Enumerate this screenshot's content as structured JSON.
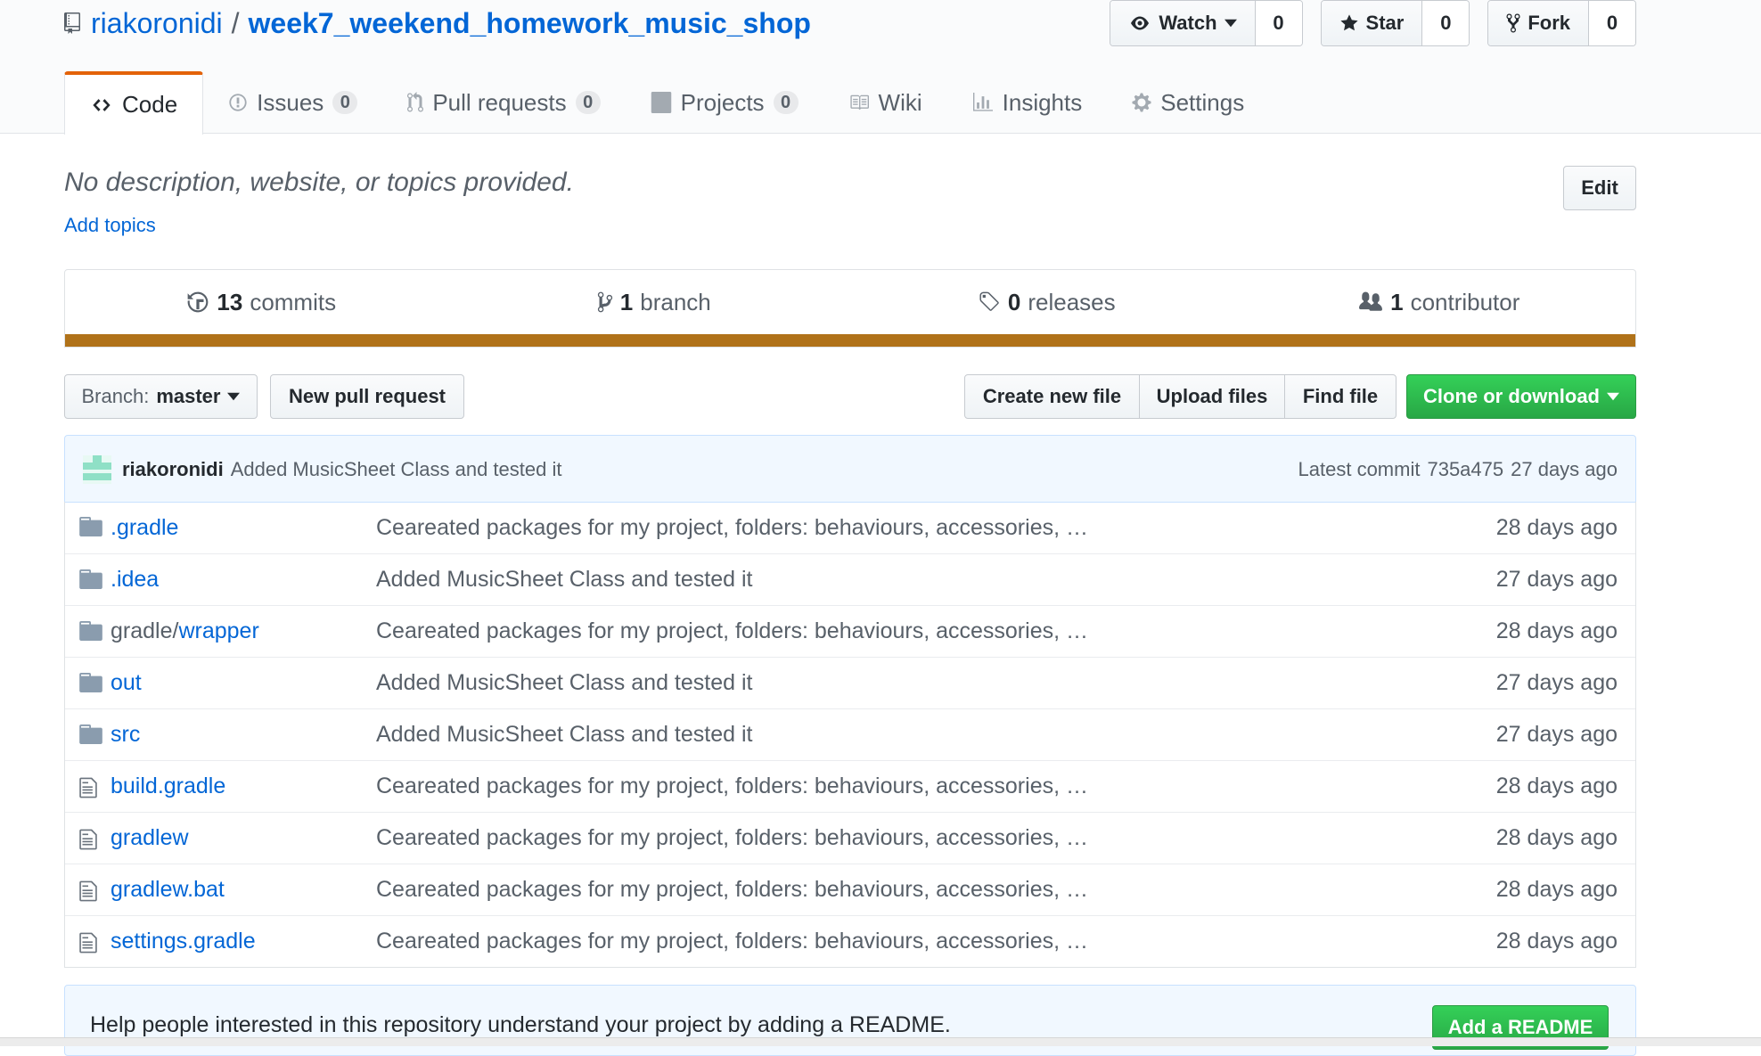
{
  "repo": {
    "owner": "riakoronidi",
    "separator": "/",
    "name": "week7_weekend_homework_music_shop"
  },
  "actions": {
    "watch": {
      "label": "Watch",
      "count": "0"
    },
    "star": {
      "label": "Star",
      "count": "0"
    },
    "fork": {
      "label": "Fork",
      "count": "0"
    }
  },
  "tabs": [
    {
      "label": "Code",
      "icon": "code-icon",
      "selected": true
    },
    {
      "label": "Issues",
      "counter": "0",
      "icon": "issue-icon"
    },
    {
      "label": "Pull requests",
      "counter": "0",
      "icon": "pull-request-icon"
    },
    {
      "label": "Projects",
      "counter": "0",
      "icon": "project-icon"
    },
    {
      "label": "Wiki",
      "icon": "book-icon"
    },
    {
      "label": "Insights",
      "icon": "graph-icon"
    },
    {
      "label": "Settings",
      "icon": "gear-icon"
    }
  ],
  "description": {
    "text": "No description, website, or topics provided.",
    "add_topics": "Add topics",
    "edit_label": "Edit"
  },
  "summary": {
    "commits_count": "13",
    "commits_label": "commits",
    "branches_count": "1",
    "branches_label": "branch",
    "releases_count": "0",
    "releases_label": "releases",
    "contributors_count": "1",
    "contributors_label": "contributor",
    "language_color": "#b07219"
  },
  "filenav": {
    "branch_prefix": "Branch:",
    "branch_name": "master",
    "new_pr": "New pull request",
    "create_file": "Create new file",
    "upload_files": "Upload files",
    "find_file": "Find file",
    "clone": "Clone or download"
  },
  "latest_commit": {
    "author": "riakoronidi",
    "message": "Added MusicSheet Class and tested it",
    "label": "Latest commit",
    "sha": "735a475",
    "age": "27 days ago"
  },
  "files": [
    {
      "name": ".gradle",
      "type": "dir",
      "message": "Ceareated packages for my project, folders: behaviours, accessories, …",
      "age": "28 days ago"
    },
    {
      "name": ".idea",
      "type": "dir",
      "message": "Added MusicSheet Class and tested it",
      "age": "27 days ago"
    },
    {
      "dir_prefix": "gradle/",
      "name": "wrapper",
      "type": "dir",
      "message": "Ceareated packages for my project, folders: behaviours, accessories, …",
      "age": "28 days ago"
    },
    {
      "name": "out",
      "type": "dir",
      "message": "Added MusicSheet Class and tested it",
      "age": "27 days ago"
    },
    {
      "name": "src",
      "type": "dir",
      "message": "Added MusicSheet Class and tested it",
      "age": "27 days ago"
    },
    {
      "name": "build.gradle",
      "type": "file",
      "message": "Ceareated packages for my project, folders: behaviours, accessories, …",
      "age": "28 days ago"
    },
    {
      "name": "gradlew",
      "type": "file",
      "message": "Ceareated packages for my project, folders: behaviours, accessories, …",
      "age": "28 days ago"
    },
    {
      "name": "gradlew.bat",
      "type": "file",
      "message": "Ceareated packages for my project, folders: behaviours, accessories, …",
      "age": "28 days ago"
    },
    {
      "name": "settings.gradle",
      "type": "file",
      "message": "Ceareated packages for my project, folders: behaviours, accessories, …",
      "age": "28 days ago"
    }
  ],
  "readme_prompt": {
    "text": "Help people interested in this repository understand your project by adding a README.",
    "button": "Add a README"
  },
  "colors": {
    "link": "#0366d6",
    "muted": "#586069",
    "accent_tab": "#e36209",
    "green_button": "#28a745",
    "commit_bg": "#f1f8ff"
  }
}
